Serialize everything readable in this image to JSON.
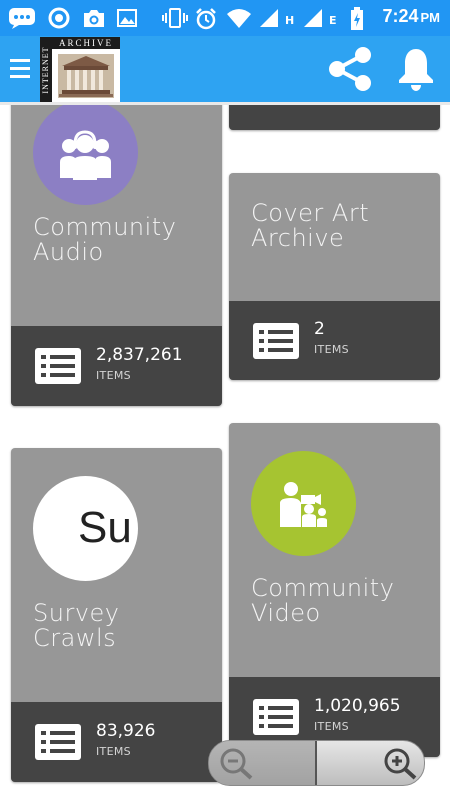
{
  "status_bar": {
    "time": "7:24",
    "time_suffix": "PM",
    "net_h": "H",
    "net_e": "E",
    "color": "#2196f3"
  },
  "toolbar": {
    "logo_top_text": "ARCHIVE",
    "logo_side_text": "INTERNET",
    "menu_icon": "hamburger-icon",
    "share_icon": "share-icon",
    "bell_icon": "bell-icon"
  },
  "cards": [
    {
      "title": "Community\nAudio",
      "count": "2,837,261",
      "items_label": "ITEMS",
      "icon": "people-headphones-icon",
      "circle_color": "#8c7fc4"
    },
    {
      "title": "Cover Art\nArchive",
      "count": "2",
      "items_label": "ITEMS"
    },
    {
      "title": "Survey\nCrawls",
      "count": "83,926",
      "items_label": "ITEMS",
      "icon_text": "Su"
    },
    {
      "title": "Community\nVideo",
      "count": "1,020,965",
      "items_label": "ITEMS",
      "icon": "video-people-icon",
      "circle_color": "#a6c431"
    }
  ],
  "zoom_controls": {
    "zoom_out_icon": "zoom-out-icon",
    "zoom_in_icon": "zoom-in-icon"
  }
}
